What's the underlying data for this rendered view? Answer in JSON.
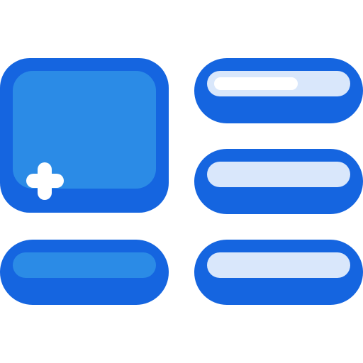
{
  "icon": {
    "name": "layout-grid-icon",
    "colors": {
      "outline": "#1565e0",
      "primary_fill": "#2b8be6",
      "light_fill": "#d9e7fb",
      "highlight": "#ffffff",
      "background": "#ffffff"
    },
    "elements": [
      "image-block-with-plus",
      "wide-bar-bottom-left",
      "bar-top-right",
      "bar-middle-right",
      "bar-bottom-right"
    ]
  }
}
